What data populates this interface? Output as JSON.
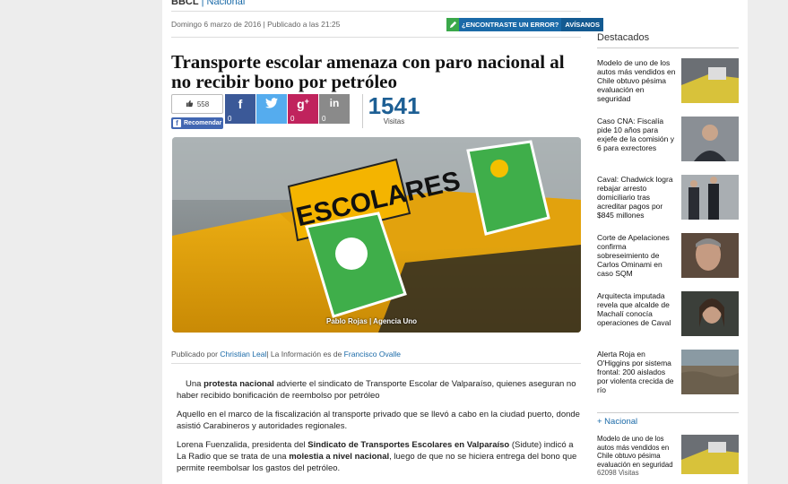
{
  "header": {
    "section_partial": "BBCL",
    "section_link": "Nacional"
  },
  "article": {
    "date_line": "Domingo 6 marzo de 2016 | Publicado a las 21:25",
    "error_label": "¿ENCONTRASTE UN ERROR?",
    "error_action": "AVÍSANOS",
    "title": "Transporte escolar amenaza con paro nacional al no recibir bono por petróleo",
    "share": {
      "like_count": "558",
      "recommend_label": "Recomendar",
      "facebook_count": "0",
      "twitter_count": "",
      "googleplus_count": "0",
      "linkedin_count": "0"
    },
    "visits_number": "1541",
    "visits_label": "Visitas",
    "photo_credit": "Pablo Rojas | Agencia Uno",
    "photo_sign_escolares": "ESCOLARES",
    "byline_prefix": "Publicado por",
    "author": "Christian Leal",
    "byline_middle": "| La Información es de",
    "source": "Francisco Ovalle",
    "paragraphs": {
      "p1_a": "Una ",
      "p1_b": "protesta nacional",
      "p1_c": " advierte el sindicato de Transporte Escolar de Valparaíso, quienes aseguran no haber recibido bonificación de reembolso por petróleo",
      "p2": "Aquello en el marco de la fiscalización al transporte privado que se llevó a cabo en la ciudad puerto, donde asistió Carabineros y autoridades regionales.",
      "p3_a": "Lorena Fuenzalida, presidenta del ",
      "p3_b": "Sindicato de Transportes Escolares en Valparaíso",
      "p3_c": " (Sidute) indicó a La Radio que se trata de una ",
      "p3_d": "molestia a nivel nacional",
      "p3_e": ", luego de que no se hiciera entrega del bono que permite reembolsar los gastos del petróleo."
    }
  },
  "sidebar": {
    "heading": "Destacados",
    "items": [
      {
        "text": "Modelo de uno de los autos más vendidos en Chile obtuvo pésima evaluación en seguridad"
      },
      {
        "text": "Caso CNA: Fiscalía pide 10 años para exjefe de la comisión y 6 para exrectores"
      },
      {
        "text": "Caval: Chadwick logra rebajar arresto domiciliario tras acreditar pagos por $845 millones"
      },
      {
        "text": "Corte de Apelaciones confirma sobreseimiento de Carlos Ominami en caso SQM"
      },
      {
        "text": "Arquitecta imputada revela que alcalde de Machalí conocía operaciones de Caval"
      },
      {
        "text": "Alerta Roja en O'Higgins por sistema frontal: 200 aislados por violenta crecida de río"
      }
    ],
    "section_label": "+ Nacional",
    "section_item": {
      "text": "Modelo de uno de los autos más vendidos en Chile obtuvo pésima evaluación en seguridad",
      "visits": "62098 Visitas"
    }
  },
  "colors": {
    "accent_blue": "#1a6aa8",
    "facebook": "#3b5998",
    "twitter": "#55acee",
    "googleplus": "#c0235d",
    "linkedin": "#8a8a8a"
  }
}
